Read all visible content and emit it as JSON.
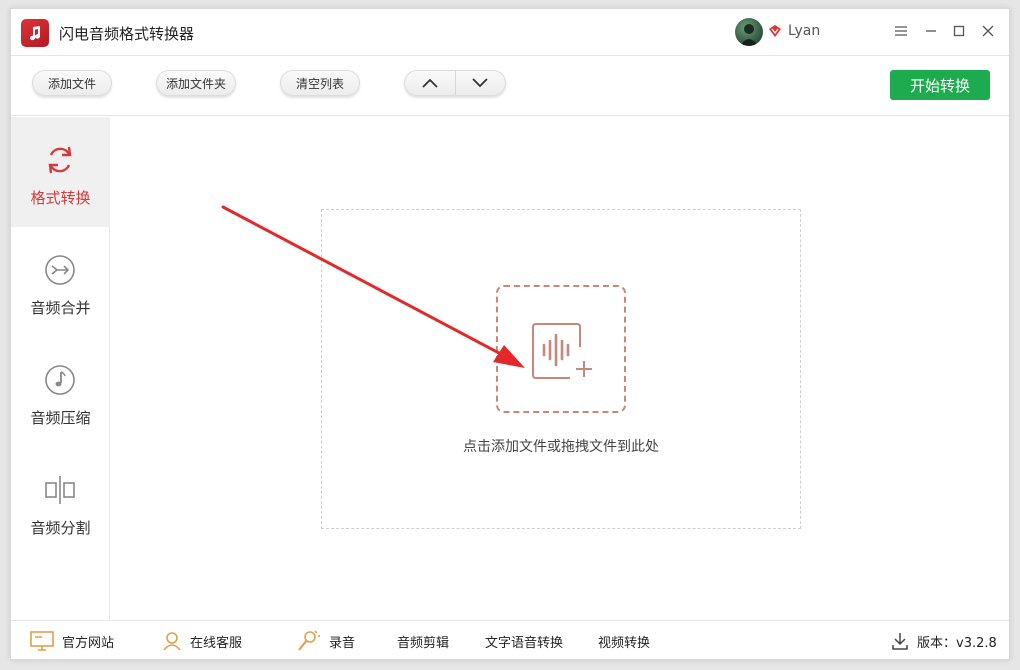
{
  "app": {
    "title": "闪电音频格式转换器"
  },
  "user": {
    "name": "Lyan"
  },
  "window_controls": {
    "menu": "☰",
    "minimize": "—",
    "maximize": "☐",
    "close": "✕"
  },
  "toolbar": {
    "add_file": "添加文件",
    "add_folder": "添加文件夹",
    "clear_list": "清空列表",
    "start": "开始转换"
  },
  "sidebar": {
    "items": [
      {
        "label": "格式转换",
        "icon": "refresh-icon",
        "active": true
      },
      {
        "label": "音频合并",
        "icon": "merge-icon",
        "active": false
      },
      {
        "label": "音频压缩",
        "icon": "music-note-icon",
        "active": false
      },
      {
        "label": "音频分割",
        "icon": "split-icon",
        "active": false
      }
    ]
  },
  "main": {
    "drop_hint": "点击添加文件或拖拽文件到此处"
  },
  "footer": {
    "website": "官方网站",
    "support": "在线客服",
    "record": "录音",
    "audio_edit": "音频剪辑",
    "tts": "文字语音转换",
    "video_convert": "视频转换",
    "version": "版本：v3.2.8"
  },
  "colors": {
    "accent_red": "#d63a3a",
    "start_green": "#1eaa4e",
    "drop_border": "#c9877b"
  }
}
